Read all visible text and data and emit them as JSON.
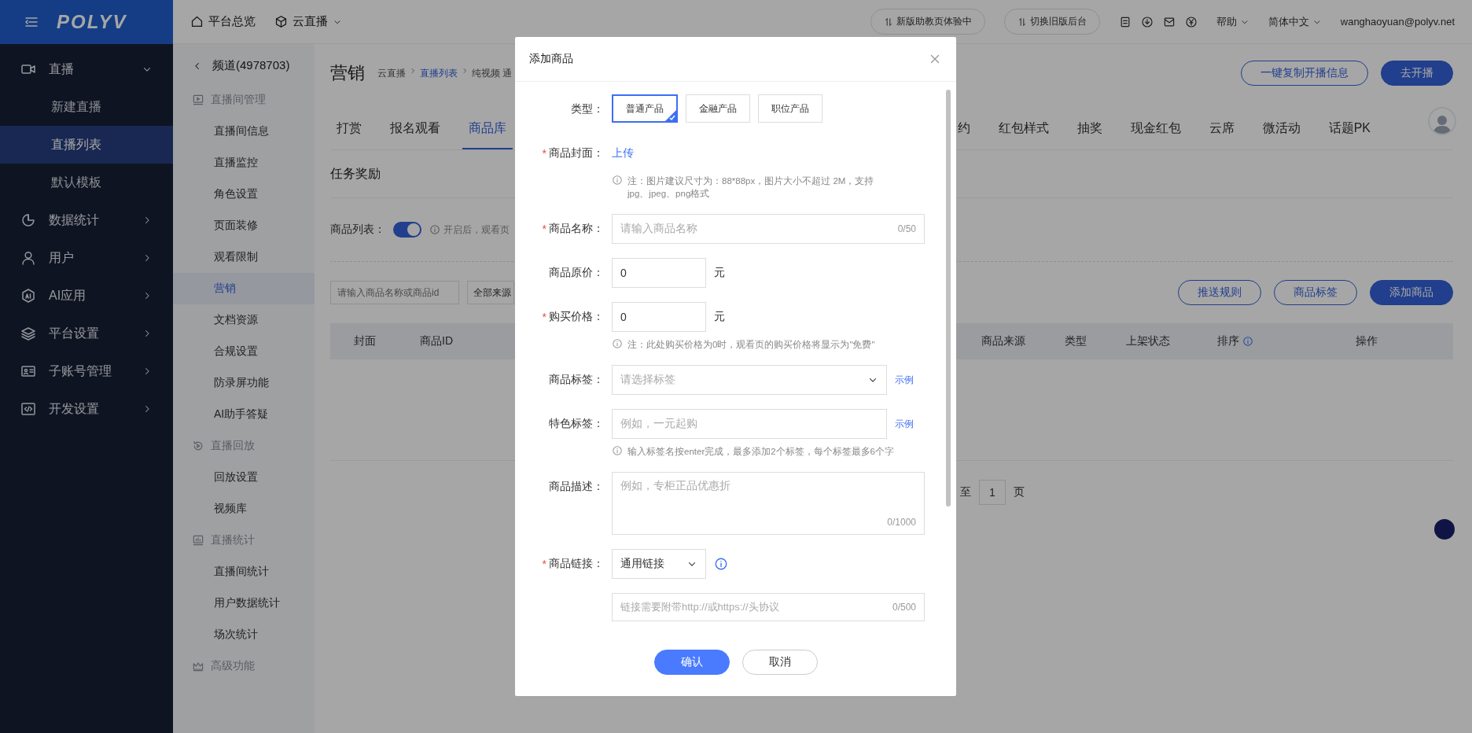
{
  "top_bar": {
    "logo": "POLYV",
    "nav": [
      {
        "label": "平台总览",
        "dropdown": false
      },
      {
        "label": "云直播",
        "dropdown": true
      }
    ],
    "buttons": [
      "新版助教页体验中",
      "切换旧版后台"
    ],
    "help": "帮助",
    "language": "简体中文",
    "user": "wanghaoyuan@polyv.net"
  },
  "sidebar": {
    "items": [
      {
        "label": "直播",
        "expanded": true,
        "children": [
          {
            "label": "新建直播",
            "selected": false
          },
          {
            "label": "直播列表",
            "selected": true
          },
          {
            "label": "默认模板",
            "selected": false
          }
        ]
      },
      {
        "label": "数据统计",
        "expanded": false
      },
      {
        "label": "用户",
        "expanded": false
      },
      {
        "label": "AI应用",
        "expanded": false
      },
      {
        "label": "平台设置",
        "expanded": false
      },
      {
        "label": "子账号管理",
        "expanded": false
      },
      {
        "label": "开发设置",
        "expanded": false
      }
    ]
  },
  "channel_menu": {
    "back": "频道(4978703)",
    "groups": [
      {
        "title": "直播间管理",
        "items": [
          {
            "label": "直播间信息",
            "selected": false
          },
          {
            "label": "直播监控",
            "selected": false
          },
          {
            "label": "角色设置",
            "selected": false
          },
          {
            "label": "页面装修",
            "selected": false
          },
          {
            "label": "观看限制",
            "selected": false
          },
          {
            "label": "营销",
            "selected": true
          },
          {
            "label": "文档资源",
            "selected": false
          },
          {
            "label": "合规设置",
            "selected": false
          },
          {
            "label": "防录屏功能",
            "selected": false
          },
          {
            "label": "AI助手答疑",
            "selected": false
          }
        ]
      },
      {
        "title": "直播回放",
        "items": [
          {
            "label": "回放设置",
            "selected": false
          },
          {
            "label": "视频库",
            "selected": false
          }
        ]
      },
      {
        "title": "直播统计",
        "items": [
          {
            "label": "直播间统计",
            "selected": false
          },
          {
            "label": "用户数据统计",
            "selected": false
          },
          {
            "label": "场次统计",
            "selected": false
          }
        ]
      },
      {
        "title": "高级功能"
      }
    ]
  },
  "page": {
    "title": "营销",
    "breadcrumb": [
      {
        "label": "云直播",
        "kind": "plain"
      },
      {
        "label": "直播列表",
        "kind": "link"
      },
      {
        "label": "纯视频 通",
        "kind": "plain"
      }
    ],
    "buttons": [
      {
        "label": "一键复制开播信息",
        "kind": "outline"
      },
      {
        "label": "去开播",
        "kind": "primary"
      }
    ],
    "tabs": [
      {
        "label": "打赏",
        "selected": false
      },
      {
        "label": "报名观看",
        "selected": false
      },
      {
        "label": "商品库",
        "selected": true
      }
    ],
    "tabs_right": [
      {
        "label": "约",
        "selected": false
      },
      {
        "label": "红包样式",
        "selected": false
      },
      {
        "label": "抽奖",
        "selected": false
      },
      {
        "label": "现金红包",
        "selected": false
      },
      {
        "label": "云席",
        "selected": false
      },
      {
        "label": "微活动",
        "selected": false
      },
      {
        "label": "话题PK",
        "selected": false
      }
    ],
    "section": "任务奖励",
    "toggle": {
      "label": "商品列表：",
      "on": true,
      "hint": "开启后，观看页"
    },
    "search": {
      "placeholder": "请输入商品名称或商品id"
    },
    "source_filter": "全部来源",
    "actions": [
      {
        "label": "推送规则",
        "kind": "outline"
      },
      {
        "label": "商品标签",
        "kind": "outline"
      },
      {
        "label": "添加商品",
        "kind": "primary"
      }
    ],
    "table": {
      "columns_left": [
        {
          "label": "封面",
          "info": false
        },
        {
          "label": "商品ID",
          "info": false
        }
      ],
      "columns_right": [
        {
          "label": "商品来源",
          "info": false
        },
        {
          "label": "类型",
          "info": false
        },
        {
          "label": "上架状态",
          "info": false
        },
        {
          "label": "排序",
          "info": true
        },
        {
          "label": "操作",
          "info": false
        }
      ]
    },
    "pagination": {
      "before": "至",
      "page": "1",
      "after": "页"
    }
  },
  "dialog": {
    "title": "添加商品",
    "fields": [
      {
        "kind": "choice",
        "label": "类型：",
        "options": [
          {
            "label": "普通产品",
            "selected": true
          },
          {
            "label": "金融产品",
            "selected": false
          },
          {
            "label": "职位产品",
            "selected": false
          }
        ]
      },
      {
        "kind": "upload",
        "label": "商品封面：",
        "required_mark": "*",
        "link": "上传",
        "note": "注：图片建议尺寸为：88*88px，图片大小不超过 2M，支持 jpg、jpeg、png格式"
      },
      {
        "kind": "text",
        "label": "商品名称：",
        "required_mark": "*",
        "placeholder": "请输入商品名称",
        "counter": "0/50"
      },
      {
        "kind": "number",
        "label": "商品原价：",
        "value": "0",
        "unit": "元"
      },
      {
        "kind": "number",
        "label": "购买价格：",
        "required_mark": "*",
        "value": "0",
        "unit": "元",
        "note": "注：此处购买价格为0时，观看页的购买价格将显示为\"免费\""
      },
      {
        "kind": "select",
        "label": "商品标签：",
        "placeholder": "请选择标签",
        "example": "示例"
      },
      {
        "kind": "tags",
        "label": "特色标签：",
        "placeholder": "例如，一元起购",
        "example": "示例",
        "note": "输入标签名按enter完成，最多添加2个标签，每个标签最多6个字"
      },
      {
        "kind": "textarea",
        "label": "商品描述：",
        "placeholder": "例如，专柜正品优惠折",
        "counter": "0/1000"
      },
      {
        "kind": "link_select",
        "label": "商品链接：",
        "required_mark": "*",
        "value": "通用链接",
        "info": true
      },
      {
        "kind": "url",
        "placeholder": "链接需要附带http://或https://头协议",
        "counter": "0/500"
      }
    ],
    "buttons": [
      {
        "label": "确认",
        "kind": "primary"
      },
      {
        "label": "取消",
        "kind": "outline"
      }
    ]
  }
}
